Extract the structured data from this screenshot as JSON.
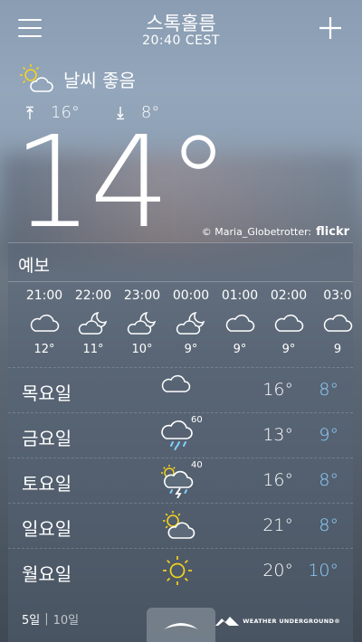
{
  "header": {
    "city": "스톡홀름",
    "time": "20:40 CEST"
  },
  "current": {
    "condition_icon": "sun-cloud-icon",
    "condition": "날씨 좋음",
    "high": "16°",
    "low": "8°",
    "temperature": "14°"
  },
  "photo_credit": {
    "author": "© Maria_Globetrotter:",
    "source": "flickr"
  },
  "forecast": {
    "title": "예보",
    "hourly": [
      {
        "time": "21:00",
        "icon": "cloud-icon",
        "temp": "12°"
      },
      {
        "time": "22:00",
        "icon": "moon-cloud-icon",
        "temp": "11°"
      },
      {
        "time": "23:00",
        "icon": "moon-cloud-icon",
        "temp": "10°"
      },
      {
        "time": "00:00",
        "icon": "moon-cloud-icon",
        "temp": "9°"
      },
      {
        "time": "01:00",
        "icon": "cloud-icon",
        "temp": "9°"
      },
      {
        "time": "02:00",
        "icon": "cloud-icon",
        "temp": "9°"
      },
      {
        "time": "03:0",
        "icon": "cloud-icon",
        "temp": "9"
      }
    ],
    "daily": [
      {
        "day": "목요일",
        "icon": "cloud-icon",
        "pop": "",
        "high": "16°",
        "low": "8°"
      },
      {
        "day": "금요일",
        "icon": "rain-cloud-icon",
        "pop": "60",
        "high": "13°",
        "low": "9°"
      },
      {
        "day": "토요일",
        "icon": "thunderstorm-icon",
        "pop": "40",
        "high": "16°",
        "low": "8°"
      },
      {
        "day": "일요일",
        "icon": "sun-cloud-icon",
        "pop": "",
        "high": "21°",
        "low": "8°"
      },
      {
        "day": "월요일",
        "icon": "sun-icon",
        "pop": "",
        "high": "20°",
        "low": "10°"
      }
    ]
  },
  "footer": {
    "five_day": "5일",
    "ten_day": "10일",
    "provider": "WEATHER UNDERGROUND®"
  },
  "colors": {
    "low_temp": "#8ed0ff",
    "sun": "#f5d21c"
  }
}
